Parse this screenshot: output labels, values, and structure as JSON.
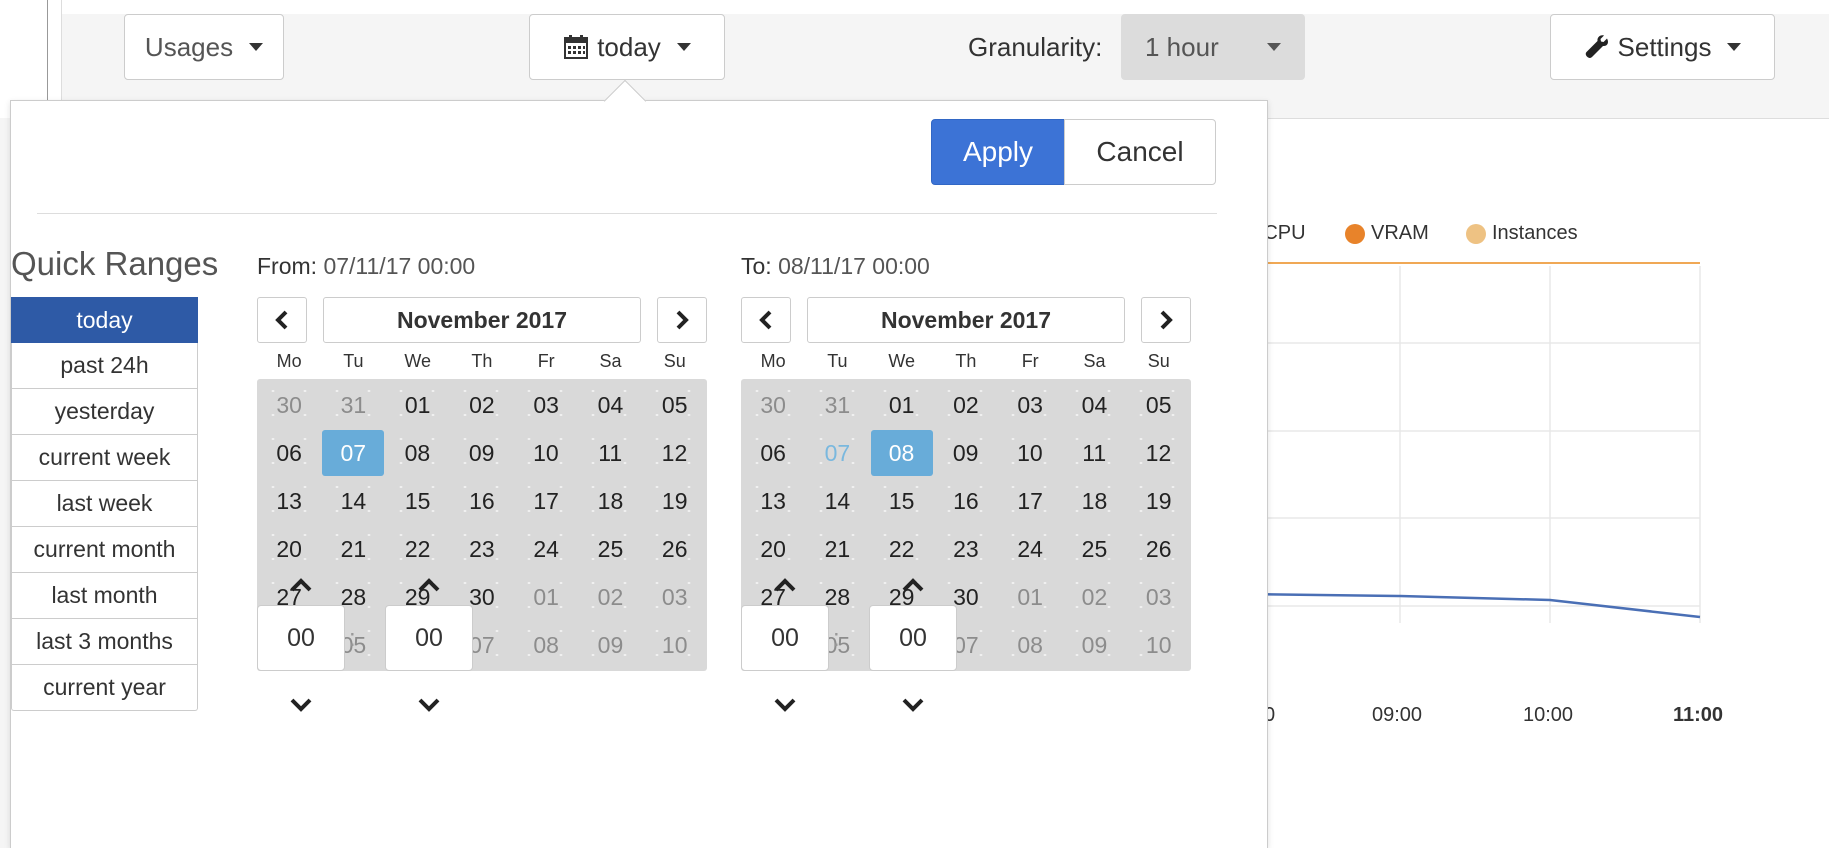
{
  "toolbar": {
    "usages_label": "Usages",
    "range_label": "today",
    "granularity_label": "Granularity:",
    "granularity_value": "1 hour",
    "settings_label": "Settings"
  },
  "popup": {
    "apply_label": "Apply",
    "cancel_label": "Cancel",
    "quick_ranges_title": "Quick Ranges",
    "quick_ranges": [
      {
        "label": "today",
        "active": true
      },
      {
        "label": "past 24h"
      },
      {
        "label": "yesterday"
      },
      {
        "label": "current week"
      },
      {
        "label": "last week"
      },
      {
        "label": "current month"
      },
      {
        "label": "last month"
      },
      {
        "label": "last 3 months"
      },
      {
        "label": "current year"
      }
    ],
    "from": {
      "label": "From:",
      "value": "07/11/17 00:00",
      "month": "November 2017",
      "hour": "00",
      "minute": "00",
      "selected_day": "07"
    },
    "to": {
      "label": "To:",
      "value": "08/11/17 00:00",
      "month": "November 2017",
      "hour": "00",
      "minute": "00",
      "range_start_day": "07",
      "selected_day": "08"
    },
    "weekdays": [
      "Mo",
      "Tu",
      "We",
      "Th",
      "Fr",
      "Sa",
      "Su"
    ],
    "weeks": [
      [
        "30",
        "31",
        "01",
        "02",
        "03",
        "04",
        "05"
      ],
      [
        "06",
        "07",
        "08",
        "09",
        "10",
        "11",
        "12"
      ],
      [
        "13",
        "14",
        "15",
        "16",
        "17",
        "18",
        "19"
      ],
      [
        "20",
        "21",
        "22",
        "23",
        "24",
        "25",
        "26"
      ],
      [
        "27",
        "28",
        "29",
        "30",
        "01",
        "02",
        "03"
      ],
      [
        "04",
        "05",
        "06",
        "07",
        "08",
        "09",
        "10"
      ]
    ],
    "muted": [
      [
        0,
        0
      ],
      [
        0,
        1
      ],
      [
        4,
        4
      ],
      [
        4,
        5
      ],
      [
        4,
        6
      ],
      [
        5,
        0
      ],
      [
        5,
        1
      ],
      [
        5,
        2
      ],
      [
        5,
        3
      ],
      [
        5,
        4
      ],
      [
        5,
        5
      ],
      [
        5,
        6
      ]
    ]
  },
  "chart": {
    "legend": [
      {
        "label": "VCPU",
        "color": "#4a6fb5"
      },
      {
        "label": "VRAM",
        "color": "#e8832a"
      },
      {
        "label": "Instances",
        "color": "#eec283"
      }
    ],
    "x_labels": [
      "0",
      "09:00",
      "10:00",
      "11:00"
    ],
    "line_color": "#4a6fb5",
    "ref_line_color": "#f0a855"
  }
}
